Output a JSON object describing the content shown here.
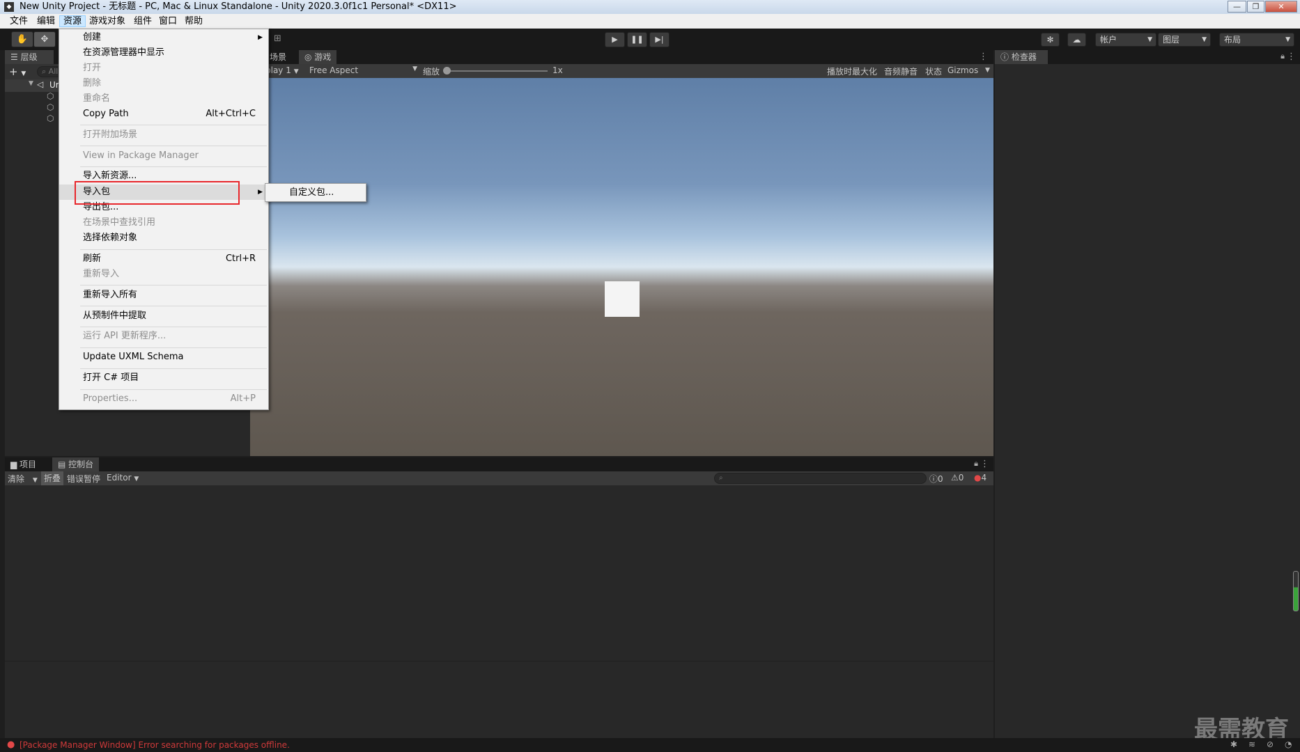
{
  "window": {
    "title": "New Unity Project - 无标题 - PC, Mac & Linux Standalone - Unity 2020.3.0f1c1 Personal* <DX11>",
    "minimize": "—",
    "maximize": "❐",
    "close": "✕"
  },
  "menubar": [
    "文件",
    "编辑",
    "资源",
    "游戏对象",
    "组件",
    "窗口",
    "帮助"
  ],
  "toolbar": {
    "account": "帐户",
    "layers": "图层",
    "layout": "布局"
  },
  "hierarchy": {
    "tab": "层级",
    "add": "+",
    "search_placeholder": "All",
    "scene": "Ur"
  },
  "viewport": {
    "tabs": [
      "场景",
      "游戏"
    ],
    "display": "play 1",
    "aspect": "Free Aspect",
    "scale_label": "缩放",
    "scale_value": "1x",
    "options": [
      "播放时最大化",
      "音频静音",
      "状态",
      "Gizmos"
    ]
  },
  "inspector": {
    "tab": "检查器"
  },
  "bottom": {
    "tabs": [
      "项目",
      "控制台"
    ],
    "toolbar": [
      "清除",
      "折叠",
      "错误暂停",
      "Editor"
    ],
    "counts": {
      "info": "0",
      "warning": "0",
      "error": "4"
    }
  },
  "menu": {
    "items": [
      {
        "label": "创建",
        "shortcut": "",
        "disabled": false,
        "submenu": true
      },
      {
        "label": "在资源管理器中显示",
        "shortcut": "",
        "disabled": false,
        "submenu": false
      },
      {
        "label": "打开",
        "shortcut": "",
        "disabled": true,
        "submenu": false
      },
      {
        "label": "删除",
        "shortcut": "",
        "disabled": true,
        "submenu": false
      },
      {
        "label": "重命名",
        "shortcut": "",
        "disabled": true,
        "submenu": false
      },
      {
        "label": "Copy Path",
        "shortcut": "Alt+Ctrl+C",
        "disabled": false,
        "submenu": false
      },
      {
        "label": "打开附加场景",
        "shortcut": "",
        "disabled": true,
        "submenu": false
      },
      {
        "label": "View in Package Manager",
        "shortcut": "",
        "disabled": true,
        "submenu": false
      },
      {
        "label": "导入新资源...",
        "shortcut": "",
        "disabled": false,
        "submenu": false
      },
      {
        "label": "导入包",
        "shortcut": "",
        "disabled": false,
        "submenu": true
      },
      {
        "label": "导出包...",
        "shortcut": "",
        "disabled": false,
        "submenu": false
      },
      {
        "label": "在场景中查找引用",
        "shortcut": "",
        "disabled": true,
        "submenu": false
      },
      {
        "label": "选择依赖对象",
        "shortcut": "",
        "disabled": false,
        "submenu": false
      },
      {
        "label": "刷新",
        "shortcut": "Ctrl+R",
        "disabled": false,
        "submenu": false
      },
      {
        "label": "重新导入",
        "shortcut": "",
        "disabled": true,
        "submenu": false
      },
      {
        "label": "重新导入所有",
        "shortcut": "",
        "disabled": false,
        "submenu": false
      },
      {
        "label": "从预制件中提取",
        "shortcut": "",
        "disabled": false,
        "submenu": false
      },
      {
        "label": "运行 API 更新程序...",
        "shortcut": "",
        "disabled": true,
        "submenu": false
      },
      {
        "label": "Update UXML Schema",
        "shortcut": "",
        "disabled": false,
        "submenu": false
      },
      {
        "label": "打开 C# 项目",
        "shortcut": "",
        "disabled": false,
        "submenu": false
      },
      {
        "label": "Properties...",
        "shortcut": "Alt+P",
        "disabled": true,
        "submenu": false
      }
    ],
    "submenu_item": "自定义包..."
  },
  "status": {
    "error_message": "[Package Manager Window] Error searching for packages offline."
  },
  "watermark": "最需教育",
  "colors": {
    "accent_red": "#e8262b",
    "error_text": "#d03a3a",
    "panel_dark": "#282828"
  }
}
